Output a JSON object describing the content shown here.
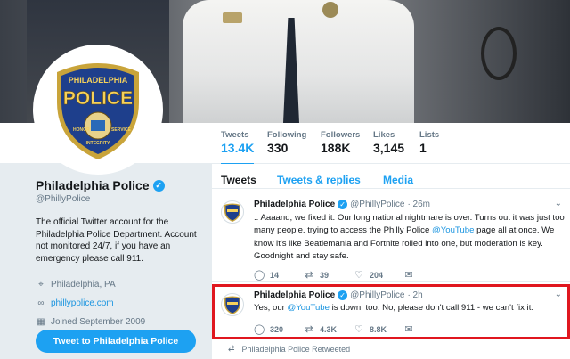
{
  "profile": {
    "name": "Philadelphia Police",
    "handle": "@PhillyPolice",
    "bio": "The official Twitter account for the Philadelphia Police Department. Account not monitored 24/7, if you have an emergency please call 911.",
    "location": "Philadelphia, PA",
    "website": "phillypolice.com",
    "joined": "Joined September 2009",
    "tweet_to_label": "Tweet to Philadelphia Police",
    "avatar_text": "PHILADELPHIA POLICE",
    "avatar_motto_left": "HONOR",
    "avatar_motto_right": "SERVICE",
    "avatar_motto_bottom": "INTEGRITY"
  },
  "stats": [
    {
      "label": "Tweets",
      "value": "13.4K",
      "active": true
    },
    {
      "label": "Following",
      "value": "330"
    },
    {
      "label": "Followers",
      "value": "188K"
    },
    {
      "label": "Likes",
      "value": "3,145"
    },
    {
      "label": "Lists",
      "value": "1"
    }
  ],
  "tabs": [
    {
      "label": "Tweets",
      "active": true
    },
    {
      "label": "Tweets & replies"
    },
    {
      "label": "Media"
    }
  ],
  "tweets": [
    {
      "name": "Philadelphia Police",
      "handle": "@PhillyPolice",
      "time": "· 26m",
      "text_before": ".. Aaaand, we fixed it. Our long national nightmare is over. Turns out it was just too many people. trying to access the Philly Police ",
      "mention": "@YouTube",
      "text_after": " page all at once. We know it's like Beatlemania and Fortnite rolled into one, but moderation is key. Goodnight and stay safe.",
      "replies": "14",
      "retweets": "39",
      "likes": "204"
    },
    {
      "name": "Philadelphia Police",
      "handle": "@PhillyPolice",
      "time": "· 2h",
      "text_before": "Yes, our ",
      "mention": "@YouTube",
      "text_after": "  is down, too. No, please don't call 911 - we can't fix it.",
      "replies": "320",
      "retweets": "4.3K",
      "likes": "8.8K"
    }
  ],
  "retweeted_label": "Philadelphia Police Retweeted",
  "colors": {
    "accent": "#1da1f2",
    "highlight": "#e0171f",
    "muted": "#657786"
  },
  "icons": {
    "chevron": "chevron-down-icon",
    "location": "location-pin-icon",
    "link": "link-icon",
    "calendar": "calendar-icon"
  }
}
